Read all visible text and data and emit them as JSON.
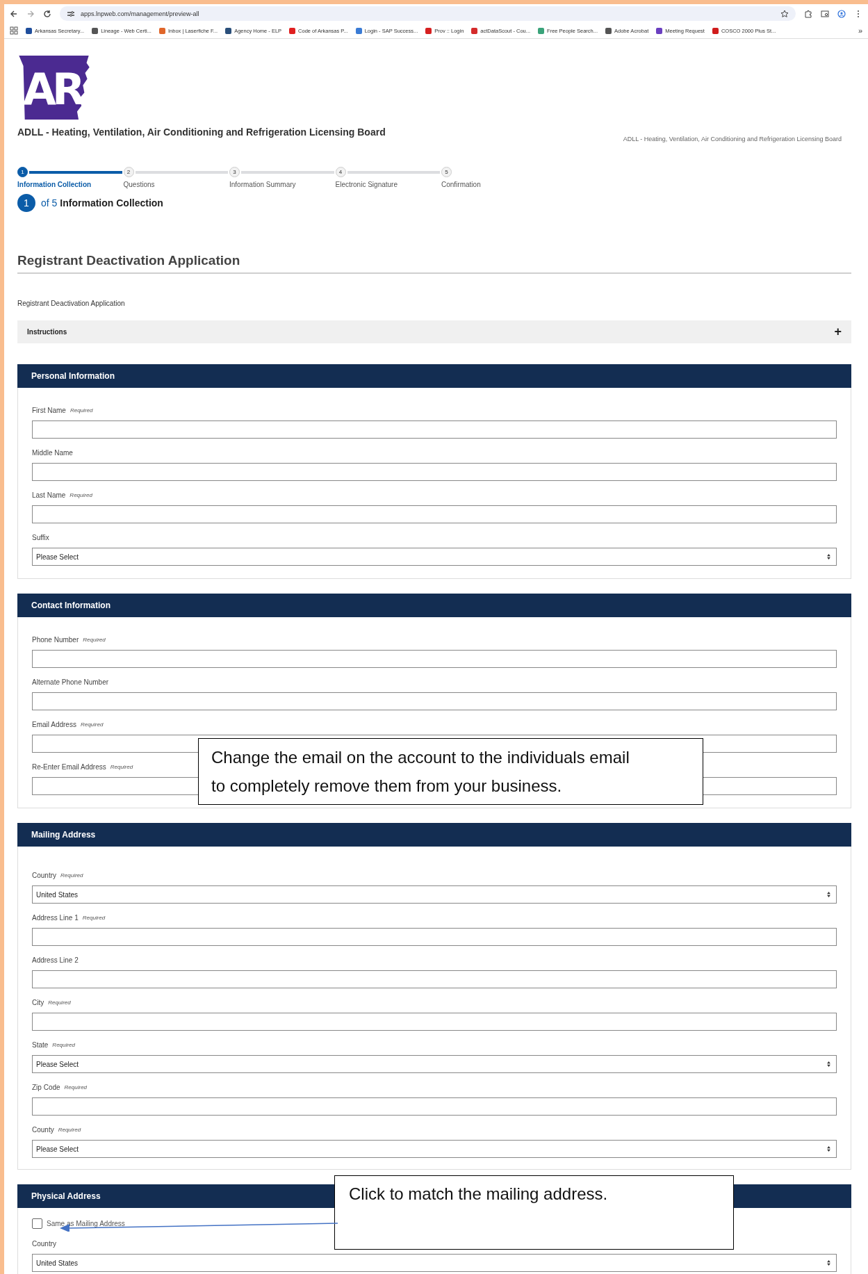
{
  "browser": {
    "url": "apps.lnpweb.com/management/preview-all",
    "bookmarks": [
      {
        "label": "Arkansas Secretary...",
        "color": "#1f4e9c"
      },
      {
        "label": "Lineage - Web Certi...",
        "color": "#555555"
      },
      {
        "label": "Inbox | Laserfiche F...",
        "color": "#e0662a"
      },
      {
        "label": "Agency Home - ELP",
        "color": "#2a4f7a"
      },
      {
        "label": "Code of Arkansas P...",
        "color": "#e02020"
      },
      {
        "label": "Login - SAP Success...",
        "color": "#3a7bd5"
      },
      {
        "label": "Prov :: Login",
        "color": "#d62020"
      },
      {
        "label": "actDataScout - Cou...",
        "color": "#d42b2b"
      },
      {
        "label": "Free People Search...",
        "color": "#3aa37a"
      },
      {
        "label": "Adobe Acrobat",
        "color": "#555555"
      },
      {
        "label": "Meeting Request",
        "color": "#6a3fc0"
      },
      {
        "label": "COSCO 2000 Plus St...",
        "color": "#d01c1c"
      }
    ],
    "more": "»"
  },
  "header": {
    "logo": "AR",
    "board_name": "ADLL - Heating, Ventilation, Air Conditioning and Refrigeration Licensing Board",
    "right_text": "ADLL - Heating, Ventilation, Air Conditioning and Refrigeration Licensing Board"
  },
  "stepper": {
    "steps": [
      {
        "number": "1",
        "label": "Information Collection",
        "selected": true
      },
      {
        "number": "2",
        "label": "Questions",
        "selected": false
      },
      {
        "number": "3",
        "label": "Information Summary",
        "selected": false
      },
      {
        "number": "4",
        "label": "Electronic Signature",
        "selected": false
      },
      {
        "number": "5",
        "label": "Confirmation",
        "selected": false
      }
    ],
    "current": {
      "number": "1",
      "of": "of 5",
      "title": "Information Collection"
    }
  },
  "form": {
    "title": "Registrant Deactivation Application",
    "description": "Registrant Deactivation Application",
    "instructions": {
      "label": "Instructions",
      "expanded": false,
      "toggle": "+"
    },
    "sections": [
      {
        "title": "Personal Information",
        "fields": [
          {
            "kind": "text",
            "label": "First Name",
            "required": "Required"
          },
          {
            "kind": "text",
            "label": "Middle Name"
          },
          {
            "kind": "text",
            "label": "Last Name",
            "required": "Required"
          },
          {
            "kind": "select",
            "label": "Suffix",
            "value": "Please Select"
          }
        ]
      },
      {
        "title": "Contact Information",
        "fields": [
          {
            "kind": "text",
            "label": "Phone Number",
            "required": "Required"
          },
          {
            "kind": "text",
            "label": "Alternate Phone Number"
          },
          {
            "kind": "text",
            "label": "Email Address",
            "required": "Required"
          },
          {
            "kind": "text",
            "label": "Re-Enter Email Address",
            "required": "Required"
          }
        ]
      },
      {
        "title": "Mailing Address",
        "fields": [
          {
            "kind": "select",
            "label": "Country",
            "required": "Required",
            "value": "United States"
          },
          {
            "kind": "text",
            "label": "Address Line 1",
            "required": "Required"
          },
          {
            "kind": "text",
            "label": "Address Line 2"
          },
          {
            "kind": "text",
            "label": "City",
            "required": "Required"
          },
          {
            "kind": "select",
            "label": "State",
            "required": "Required",
            "value": "Please Select"
          },
          {
            "kind": "text",
            "label": "Zip Code",
            "required": "Required"
          },
          {
            "kind": "select",
            "label": "County",
            "required": "Required",
            "value": "Please Select"
          }
        ]
      },
      {
        "title": "Physical Address",
        "fields": [
          {
            "kind": "checkbox",
            "label": "Same as Mailing Address",
            "checked": false
          },
          {
            "kind": "select",
            "label": "Country",
            "value": "United States"
          }
        ]
      }
    ]
  },
  "annotations": [
    {
      "text": "Change the email on the account to the individuals email to completely remove them from your business."
    },
    {
      "text": "Click to match the mailing address."
    }
  ]
}
